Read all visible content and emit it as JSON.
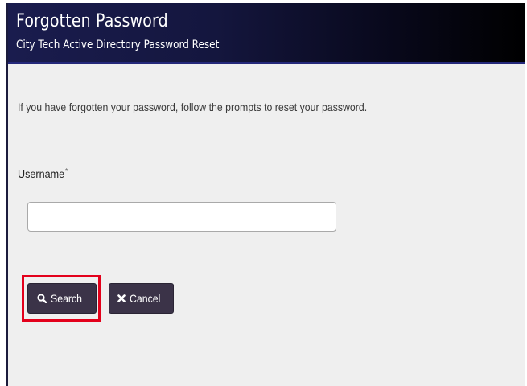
{
  "header": {
    "title": "Forgotten Password",
    "subtitle": "City Tech Active Directory Password Reset"
  },
  "main": {
    "intro": "If you have forgotten your password, follow the prompts to reset your password.",
    "username": {
      "label": "Username",
      "required_marker": "*",
      "value": "",
      "placeholder": ""
    },
    "buttons": {
      "search": {
        "label": "Search",
        "icon": "search-icon"
      },
      "cancel": {
        "label": "Cancel",
        "icon": "close-icon"
      }
    }
  },
  "annotation": {
    "highlight_target": "search-button",
    "highlight_color": "#e3001b"
  },
  "colors": {
    "header_bg": "#14163e",
    "button_bg": "#3b3348",
    "page_bg": "#efefef"
  }
}
